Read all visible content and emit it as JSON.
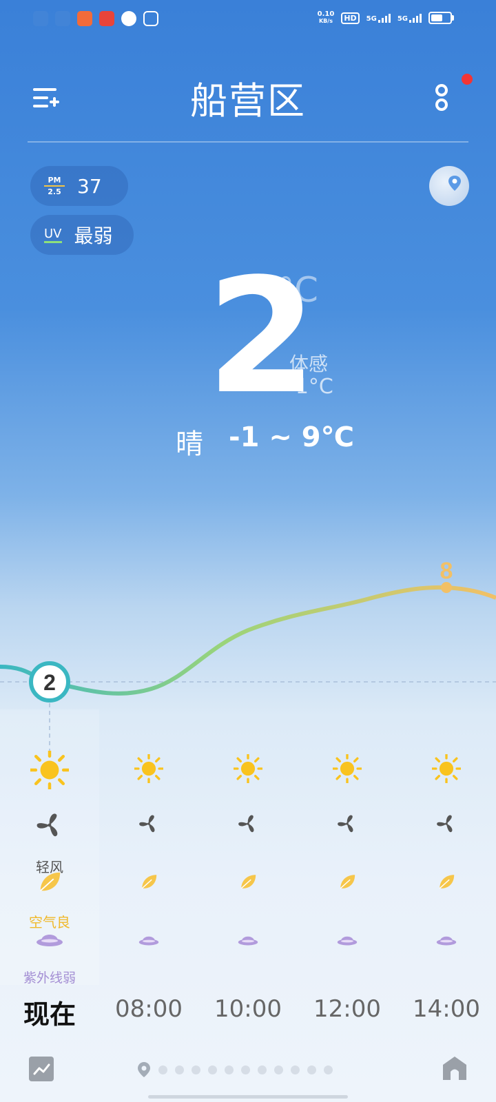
{
  "status_bar": {
    "net_speed": "0.10",
    "net_unit": "KB/s",
    "hd": "HD",
    "sim1": "5G",
    "sim2": "5G",
    "battery_level": 0.6
  },
  "header": {
    "city": "船营区"
  },
  "aqi": {
    "pm_label_top": "PM",
    "pm_label_bottom": "2.5",
    "pm_value": "37"
  },
  "uv": {
    "label": "UV",
    "value": "最弱"
  },
  "current": {
    "temp": "2",
    "unit": "°C",
    "feels_label": "体感",
    "feels_value": "-1°C",
    "condition": "晴",
    "range": "-1 ~ 9℃"
  },
  "hourly": {
    "now_temp_label": "2",
    "peak_temp_label": "8",
    "temps": [
      2,
      2,
      5,
      7,
      8
    ],
    "wind_label": "轻风",
    "air_label": "空气良",
    "uv_label": "紫外线弱",
    "times": [
      "现在",
      "08:00",
      "10:00",
      "12:00",
      "14:00"
    ]
  },
  "colors": {
    "sun": "#f9c31e",
    "fan": "#555555",
    "leaf": "#f6c64a",
    "hat": "#b19bdc",
    "curve_start": "#3ab7c2",
    "curve_end": "#f2c066"
  },
  "pager": {
    "page_count": 12
  }
}
